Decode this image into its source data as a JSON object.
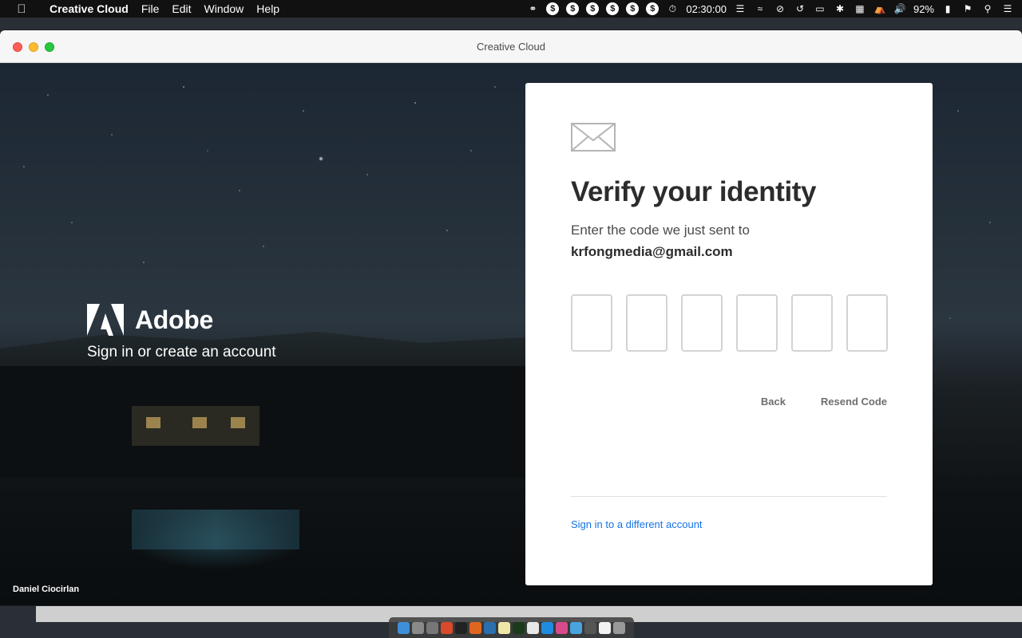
{
  "menubar": {
    "app_name": "Creative Cloud",
    "menus": [
      "File",
      "Edit",
      "Window",
      "Help"
    ],
    "time": "02:30:00",
    "battery": "92%"
  },
  "window": {
    "title": "Creative Cloud"
  },
  "brand": {
    "name": "Adobe",
    "subtitle": "Sign in or create an account",
    "photo_credit": "Daniel Ciocirlan"
  },
  "card": {
    "title": "Verify your identity",
    "subtitle": "Enter the code we just sent to",
    "email": "krfongmedia@gmail.com",
    "code_length": 6,
    "back_label": "Back",
    "resend_label": "Resend Code",
    "switch_account_label": "Sign in to a different account"
  },
  "colors": {
    "link": "#1473e6",
    "card_bg": "#ffffff",
    "title": "#2c2c2c"
  }
}
